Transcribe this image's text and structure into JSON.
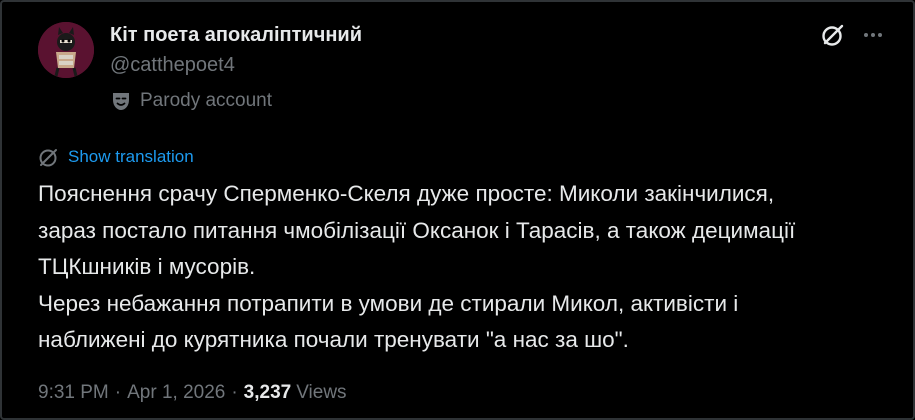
{
  "author": {
    "display_name": "Кіт поета апокаліптичний",
    "handle": "@catthepoet4",
    "badge_label": "Parody account",
    "badge_icon": "theater-mask-icon"
  },
  "actions": {
    "grok_icon": "grok-icon",
    "more_icon": "more-icon"
  },
  "translate": {
    "label": "Show translation",
    "icon": "globe-icon"
  },
  "tweet": {
    "lines": [
      "Пояснення срачу Сперменко-Скеля дуже просте: Миколи закінчилися,",
      "зараз постало питання чмобілізації Оксанок і Тарасів, а також  децимації",
      "ТЦКшників і мусорів.",
      "Через небажання потрапити в умови де стирали Микол, активісти і",
      "наближені до курятника почали тренувати \"а нас за шо\"."
    ]
  },
  "meta": {
    "time": "9:31 PM",
    "date": "Apr 1, 2026",
    "separator": "·",
    "views_count": "3,237",
    "views_label": "Views"
  },
  "colors": {
    "background": "#000000",
    "text": "#e7e9ea",
    "secondary": "#71767b",
    "link": "#1d9bf0",
    "border": "#2f3336"
  }
}
